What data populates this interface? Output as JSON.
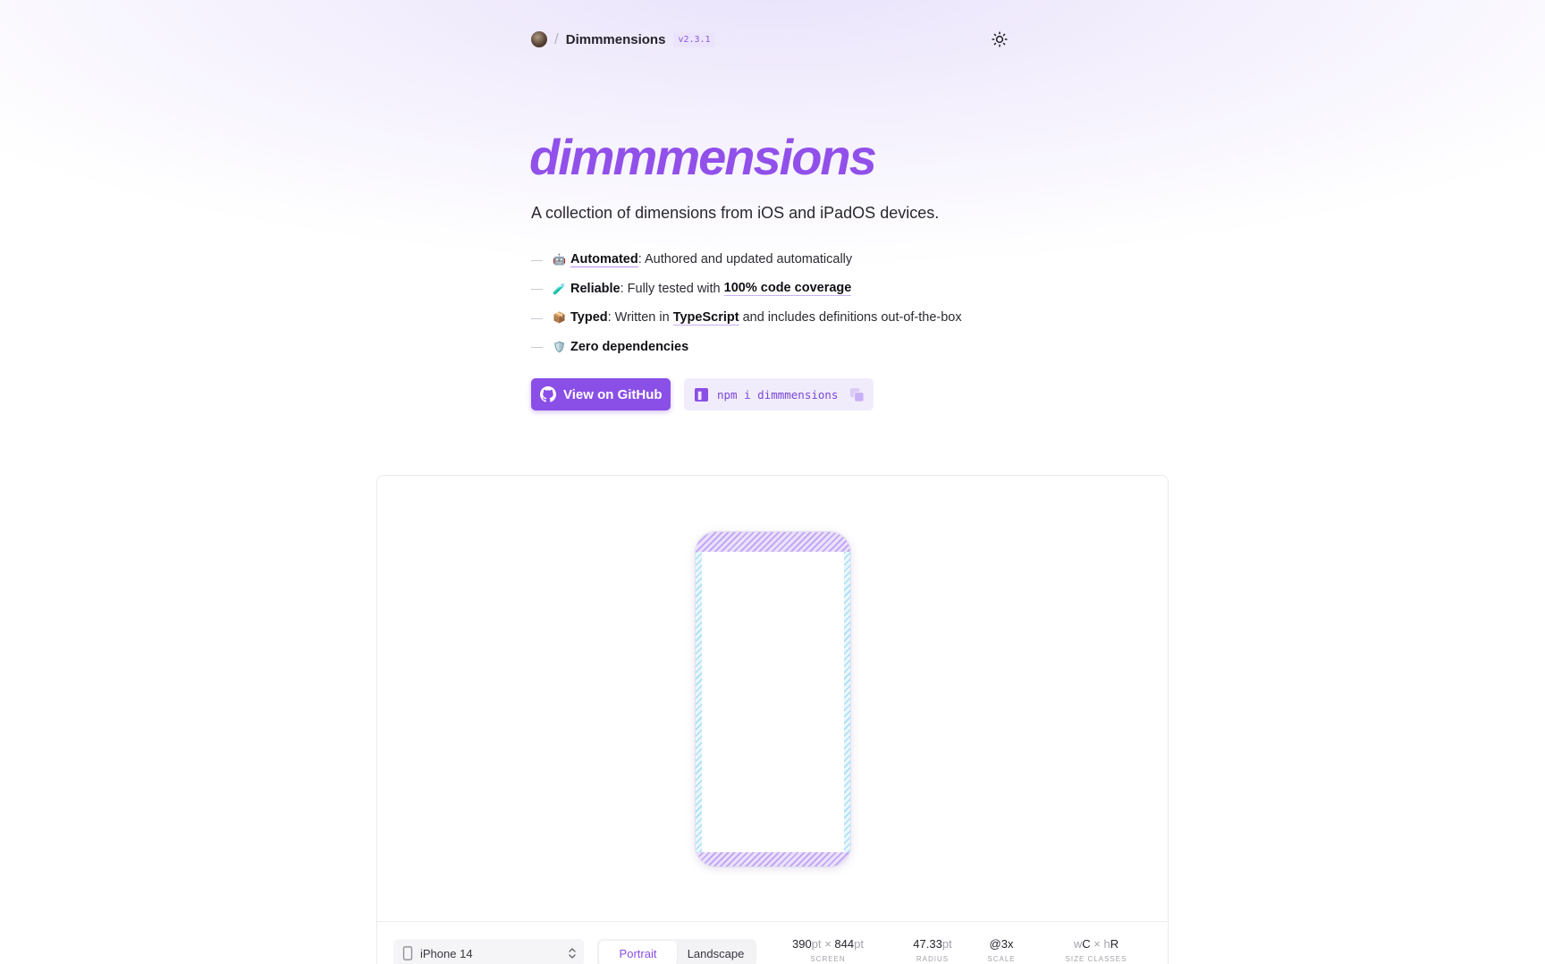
{
  "header": {
    "brand": "Dimmmensions",
    "version": "v2.3.1",
    "theme_icon": "sun-icon"
  },
  "hero": {
    "title": "dimmmensions",
    "subtitle": "A collection of dimensions from iOS and iPadOS devices."
  },
  "features": [
    {
      "emoji": "🤖",
      "name": "Automated",
      "text": ": Authored and updated automatically"
    },
    {
      "emoji": "🧪",
      "name": "Reliable",
      "text_before": ": Fully tested with ",
      "link": "100% code coverage"
    },
    {
      "emoji": "📦",
      "name": "Typed",
      "text_before": ": Written in ",
      "link": "TypeScript",
      "text_after": " and includes definitions out-of-the-box"
    },
    {
      "emoji": "🛡️",
      "name": "Zero dependencies"
    }
  ],
  "actions": {
    "github_label": "View on GitHub",
    "npm_command": "npm i dimmmensions"
  },
  "preview": {
    "device": "iPhone 14",
    "orientations": [
      "Portrait",
      "Landscape"
    ],
    "active_orientation": "Portrait",
    "stats": {
      "screen": {
        "w": "390",
        "h": "844",
        "unit": "pt",
        "label": "SCREEN"
      },
      "radius": {
        "value": "47.33",
        "unit": "pt",
        "label": "RADIUS"
      },
      "scale": {
        "value": "@3x",
        "label": "SCALE"
      },
      "size_classes": {
        "w": "C",
        "h": "R",
        "label": "SIZE CLASSES"
      }
    }
  },
  "colors": {
    "accent": "#8a4fe6",
    "title": "#9150ea",
    "safe_area_vertical": "#c3a8f3",
    "safe_area_horizontal": "#a8def5"
  }
}
